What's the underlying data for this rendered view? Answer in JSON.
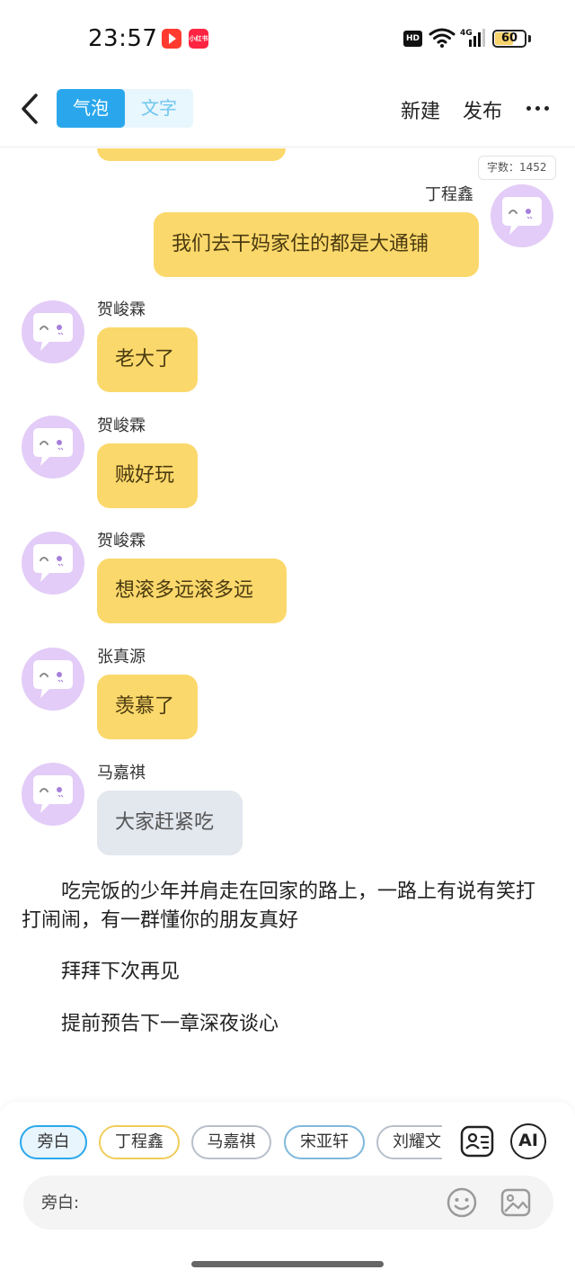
{
  "status_bar": {
    "time": "23:57",
    "network": "4G",
    "hd": "HD",
    "battery": "60",
    "battery_level": 0.6,
    "app_badge": "小红书"
  },
  "nav": {
    "back_icon": "chevron-left-icon",
    "tabs": [
      {
        "label": "气泡",
        "active": true
      },
      {
        "label": "文字",
        "active": false
      }
    ],
    "new_label": "新建",
    "publish_label": "发布",
    "more_icon": "more-horizontal-icon"
  },
  "chat": {
    "word_count": "字数：1452",
    "messages": [
      {
        "speaker": "丁程鑫",
        "text": "我们去干妈家住的都是大通铺",
        "side": "right",
        "color": "#fbd86b"
      },
      {
        "speaker": "贺峻霖",
        "text": "老大了",
        "side": "left",
        "color": "#fbd86b"
      },
      {
        "speaker": "贺峻霖",
        "text": "贼好玩",
        "side": "left",
        "color": "#fbd86b"
      },
      {
        "speaker": "贺峻霖",
        "text": "想滚多远滚多远",
        "side": "left",
        "color": "#fbd86b"
      },
      {
        "speaker": "张真源",
        "text": "羡慕了",
        "side": "left",
        "color": "#fbd86b"
      },
      {
        "speaker": "马嘉祺",
        "text": "大家赶紧吃",
        "side": "left",
        "color": "#e3e7ee"
      }
    ],
    "narration": [
      "　　吃完饭的少年并肩走在回家的路上，一路上有说有笑打打闹闹，有一群懂你的朋友真好",
      "　　拜拜下次再见",
      "　　提前预告下一章深夜谈心"
    ]
  },
  "bottom": {
    "roles": [
      "旁白",
      "丁程鑫",
      "马嘉祺",
      "宋亚轩",
      "刘耀文"
    ],
    "active_role": "旁白",
    "ai_label": "AI",
    "input_label": "旁白:",
    "icons": [
      "role-card-icon",
      "ai-icon",
      "emoji-icon",
      "image-icon"
    ]
  },
  "colors": {
    "accent": "#2aa7ec",
    "bubble_yellow": "#fbd86b",
    "bubble_gray": "#e3e7ee",
    "avatar_purple": "#e3ccf7"
  }
}
